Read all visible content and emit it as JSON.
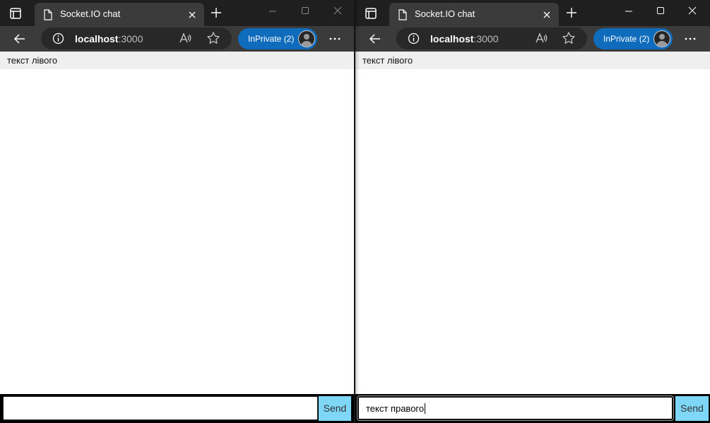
{
  "windows": [
    {
      "id": "left",
      "tab": {
        "title": "Socket.IO chat"
      },
      "address": {
        "host": "localhost",
        "port": ":3000"
      },
      "inprivate_label": "InPrivate (2)",
      "messages": [
        "текст лівого"
      ],
      "input": {
        "value": ""
      },
      "send_label": "Send"
    },
    {
      "id": "right",
      "tab": {
        "title": "Socket.IO chat"
      },
      "address": {
        "host": "localhost",
        "port": ":3000"
      },
      "inprivate_label": "InPrivate (2)",
      "messages": [
        "текст лівого"
      ],
      "input": {
        "value": "текст правого"
      },
      "send_label": "Send"
    }
  ],
  "icons": {
    "tab_actions": "tab-actions-icon",
    "page": "page-icon",
    "close": "close-icon",
    "new_tab": "plus-icon",
    "minimize": "minimize-icon",
    "maximize": "maximize-icon",
    "window_close": "window-close-icon",
    "back": "back-arrow-icon",
    "info": "info-icon",
    "read_aloud": "read-aloud-icon",
    "favorite": "star-icon",
    "profile": "avatar",
    "more": "more-icon"
  },
  "colors": {
    "titlebar": "#1f1f1f",
    "toolbar": "#3b3b3b",
    "urlbar": "#282828",
    "inprivate": "#0f6cbd",
    "message_bg": "#efefef",
    "send_button": "#7fd7f7",
    "form_bg": "#000000"
  }
}
